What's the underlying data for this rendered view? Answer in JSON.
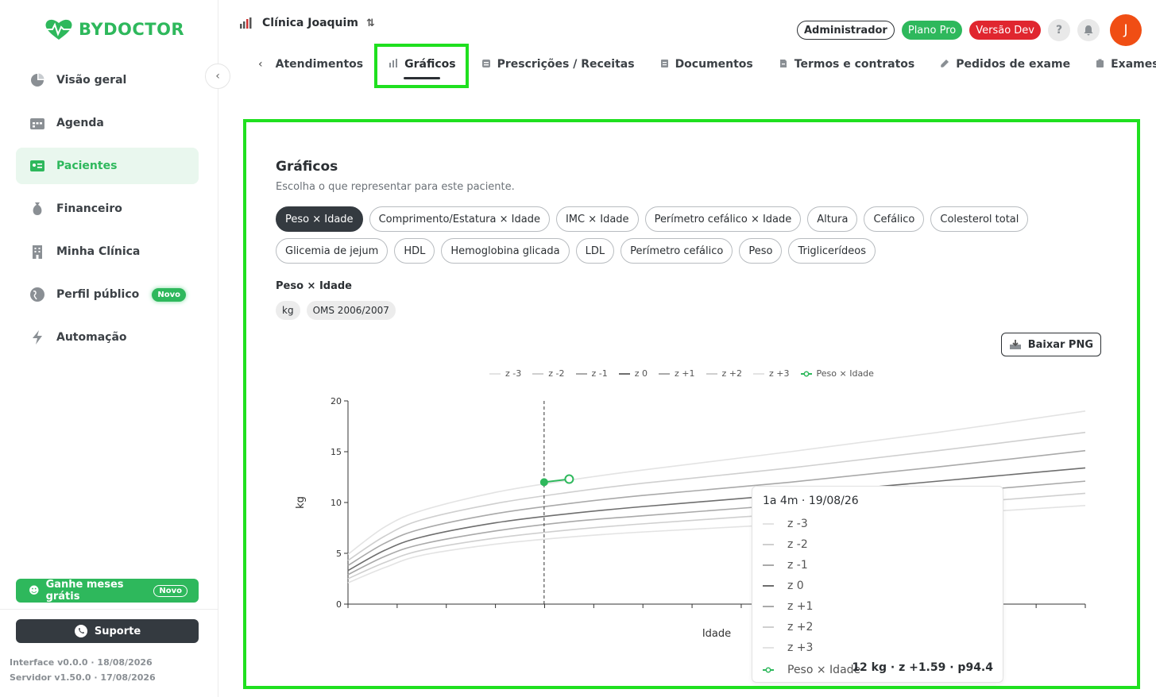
{
  "brand": {
    "name": "BYDOCTOR",
    "color": "#2eb85c"
  },
  "sidebar": {
    "items": [
      {
        "label": "Visão geral",
        "icon": "pie-chart-icon"
      },
      {
        "label": "Agenda",
        "icon": "calendar-icon"
      },
      {
        "label": "Pacientes",
        "icon": "id-card-icon",
        "active": true
      },
      {
        "label": "Financeiro",
        "icon": "money-bag-icon"
      },
      {
        "label": "Minha Clínica",
        "icon": "building-icon"
      },
      {
        "label": "Perfil público",
        "icon": "globe-icon",
        "badge": "Novo"
      },
      {
        "label": "Automação",
        "icon": "lightning-icon"
      }
    ],
    "promo": {
      "label": "Ganhe meses grátis",
      "badge": "Novo"
    },
    "support_label": "Suporte",
    "interface_version": "Interface v0.0.0 · 18/08/2026",
    "server_version": "Servidor v1.50.0 · 17/08/2026"
  },
  "header": {
    "clinic_name": "Clínica Joaquim",
    "role": "Administrador",
    "plan": "Plano Pro",
    "version_badge": "Versão Dev",
    "help_label": "?",
    "avatar_initial": "J",
    "colors": {
      "plan": "#2eb85c",
      "version": "#e0262f",
      "avatar": "#f04e14"
    }
  },
  "tabs": [
    {
      "label": "Atendimentos",
      "icon": ""
    },
    {
      "label": "Gráficos",
      "icon": "bar-chart-icon",
      "active": true
    },
    {
      "label": "Prescrições / Receitas",
      "icon": "prescription-icon"
    },
    {
      "label": "Documentos",
      "icon": "document-icon"
    },
    {
      "label": "Termos e contratos",
      "icon": "contract-icon"
    },
    {
      "label": "Pedidos de exame",
      "icon": "test-tube-icon"
    },
    {
      "label": "Exames",
      "icon": "exam-icon"
    }
  ],
  "panel": {
    "title": "Gráficos",
    "subtitle": "Escolha o que representar para este paciente.",
    "chips": [
      {
        "label": "Peso × Idade",
        "selected": true
      },
      {
        "label": "Comprimento/Estatura × Idade"
      },
      {
        "label": "IMC × Idade"
      },
      {
        "label": "Perímetro cefálico × Idade"
      },
      {
        "label": "Altura"
      },
      {
        "label": "Cefálico"
      },
      {
        "label": "Colesterol total"
      },
      {
        "label": "Glicemia de jejum"
      },
      {
        "label": "HDL"
      },
      {
        "label": "Hemoglobina glicada"
      },
      {
        "label": "LDL"
      },
      {
        "label": "Perímetro cefálico"
      },
      {
        "label": "Peso"
      },
      {
        "label": "Triglicerídeos"
      }
    ],
    "section_title": "Peso × Idade",
    "tags": [
      "kg",
      "OMS 2006/2007"
    ],
    "download_label": "Baixar PNG"
  },
  "chart_data": {
    "type": "line",
    "ylabel": "kg",
    "xlabel": "Idade",
    "ylim": [
      0,
      20
    ],
    "yticks": [
      0,
      5,
      10,
      15,
      20
    ],
    "legend_position": "top-center",
    "series": [
      {
        "name": "z -3",
        "color": "#e3e3e3",
        "x": [
          0,
          0.25,
          0.5,
          1,
          1.5,
          2,
          3,
          4,
          5
        ],
        "values": [
          2.1,
          3.6,
          4.8,
          5.9,
          6.6,
          7.1,
          7.9,
          8.8,
          9.7
        ]
      },
      {
        "name": "z -2",
        "color": "#cfcfcf",
        "x": [
          0,
          0.25,
          0.5,
          1,
          1.5,
          2,
          3,
          4,
          5
        ],
        "values": [
          2.5,
          4.1,
          5.3,
          6.5,
          7.3,
          7.9,
          8.9,
          9.8,
          10.9
        ]
      },
      {
        "name": "z -1",
        "color": "#a9a9a9",
        "x": [
          0,
          0.25,
          0.5,
          1,
          1.5,
          2,
          3,
          4,
          5
        ],
        "values": [
          2.9,
          4.7,
          5.9,
          7.2,
          8.1,
          8.7,
          9.8,
          10.9,
          12.1
        ]
      },
      {
        "name": "z 0",
        "color": "#6e6e6e",
        "x": [
          0,
          0.25,
          0.5,
          1,
          1.5,
          2,
          3,
          4,
          5
        ],
        "values": [
          3.3,
          5.3,
          6.6,
          8.0,
          8.9,
          9.6,
          10.8,
          12.1,
          13.4
        ]
      },
      {
        "name": "z +1",
        "color": "#a9a9a9",
        "x": [
          0,
          0.25,
          0.5,
          1,
          1.5,
          2,
          3,
          4,
          5
        ],
        "values": [
          3.8,
          6.0,
          7.4,
          8.9,
          9.9,
          10.7,
          12.0,
          13.5,
          15.1
        ]
      },
      {
        "name": "z +2",
        "color": "#cfcfcf",
        "x": [
          0,
          0.25,
          0.5,
          1,
          1.5,
          2,
          3,
          4,
          5
        ],
        "values": [
          4.3,
          6.7,
          8.3,
          9.9,
          11.0,
          11.9,
          13.4,
          15.1,
          16.9
        ]
      },
      {
        "name": "z +3",
        "color": "#e3e3e3",
        "x": [
          0,
          0.25,
          0.5,
          1,
          1.5,
          2,
          3,
          4,
          5
        ],
        "values": [
          4.9,
          7.6,
          9.2,
          11.0,
          12.2,
          13.2,
          15.0,
          16.9,
          19.0
        ]
      },
      {
        "name": "Peso × Idade",
        "color": "#2eb85c",
        "x": [
          1.33,
          1.5
        ],
        "values": [
          12.0,
          12.3
        ]
      }
    ],
    "cursor_x": 1.33,
    "tooltip": {
      "title": "1a 4m · 19/08/26",
      "value_text": "12 kg · z +1.59 · p94.4"
    }
  }
}
